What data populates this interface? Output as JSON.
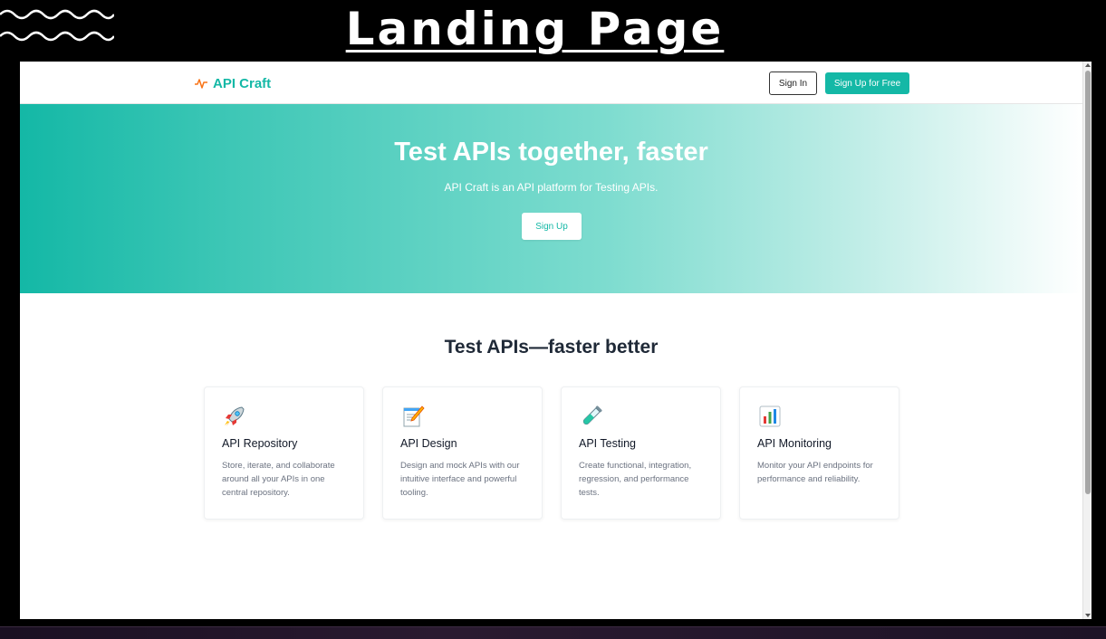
{
  "slide": {
    "title": "Landing Page"
  },
  "navbar": {
    "brand": "API Craft",
    "signin_label": "Sign In",
    "signup_label": "Sign Up for Free"
  },
  "hero": {
    "title": "Test APIs together, faster",
    "subtitle": "API Craft is an API platform for Testing APIs.",
    "button_label": "Sign Up"
  },
  "features": {
    "title": "Test APIs—faster better",
    "cards": [
      {
        "icon": "rocket-icon",
        "title": "API Repository",
        "description": "Store, iterate, and collaborate around all your APIs in one central repository."
      },
      {
        "icon": "memo-icon",
        "title": "API Design",
        "description": "Design and mock APIs with our intuitive interface and powerful tooling."
      },
      {
        "icon": "test-tube-icon",
        "title": "API Testing",
        "description": "Create functional, integration, regression, and performance tests."
      },
      {
        "icon": "bar-chart-icon",
        "title": "API Monitoring",
        "description": "Monitor your API endpoints for performance and reliability."
      }
    ]
  },
  "colors": {
    "accent": "#14b8a6",
    "heading": "#1f2937",
    "muted": "#6b7280"
  }
}
